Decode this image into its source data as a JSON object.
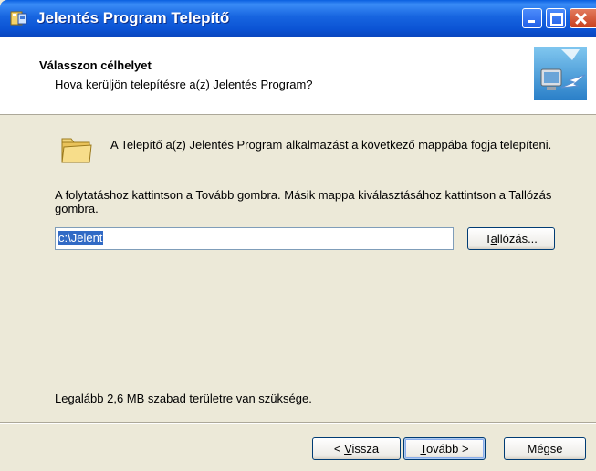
{
  "window": {
    "title": "Jelentés Program Telepítő"
  },
  "header": {
    "title": "Válasszon célhelyet",
    "subtitle": "Hova kerüljön telepítésre a(z) Jelentés Program?"
  },
  "body": {
    "intro": "A Telepítő a(z) Jelentés Program alkalmazást a következő mappába fogja telepíteni.",
    "instruction": "A folytatáshoz kattintson a Tovább gombra. Másik mappa kiválasztásához kattintson a Tallózás gombra.",
    "path_value": "c:\\Jelent",
    "browse_button": {
      "pre": "T",
      "accel": "a",
      "post": "llózás..."
    },
    "space_required": "Legalább 2,6 MB szabad területre van szüksége."
  },
  "buttons": {
    "back": {
      "pre": "< ",
      "accel": "V",
      "post": "issza"
    },
    "next": {
      "pre": "",
      "accel": "T",
      "post": "ovább >"
    },
    "cancel": "Mégse"
  },
  "icons": {
    "app": "installer-icon",
    "header": "computer-install-icon",
    "folder": "folder-icon"
  }
}
